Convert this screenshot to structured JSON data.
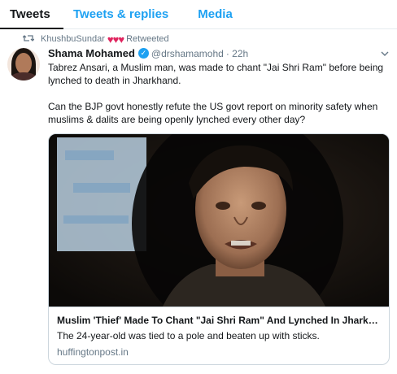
{
  "tabs": [
    {
      "label": "Tweets"
    },
    {
      "label": "Tweets & replies"
    },
    {
      "label": "Media"
    }
  ],
  "tweet": {
    "retweeter": "KhushbuSundar",
    "retweet_hearts": "♥♥♥",
    "retweet_label": "Retweeted",
    "author_name": "Shama Mohamed",
    "author_handle": "@drshamamohd",
    "time": "· 22h",
    "paragraph1": "Tabrez Ansari, a Muslim man, was made to chant \"Jai Shri Ram\" before being lynched to death in Jharkhand.",
    "paragraph2": "Can the BJP govt honestly refute the US govt report on minority safety when muslims & dalits are being openly lynched every other day?",
    "card": {
      "title": "Muslim 'Thief' Made To Chant \"Jai Shri Ram\" And Lynched In Jharkh...",
      "description": "The 24-year-old was tied to a pole and beaten up with sticks.",
      "domain": "huffingtonpost.in"
    }
  },
  "icons": {
    "retweet": "retweet-icon",
    "verified": "verified-badge-icon",
    "more": "chevron-down-icon"
  },
  "colors": {
    "accent": "#1da1f2",
    "heart": "#e0245e",
    "muted": "#657786"
  }
}
